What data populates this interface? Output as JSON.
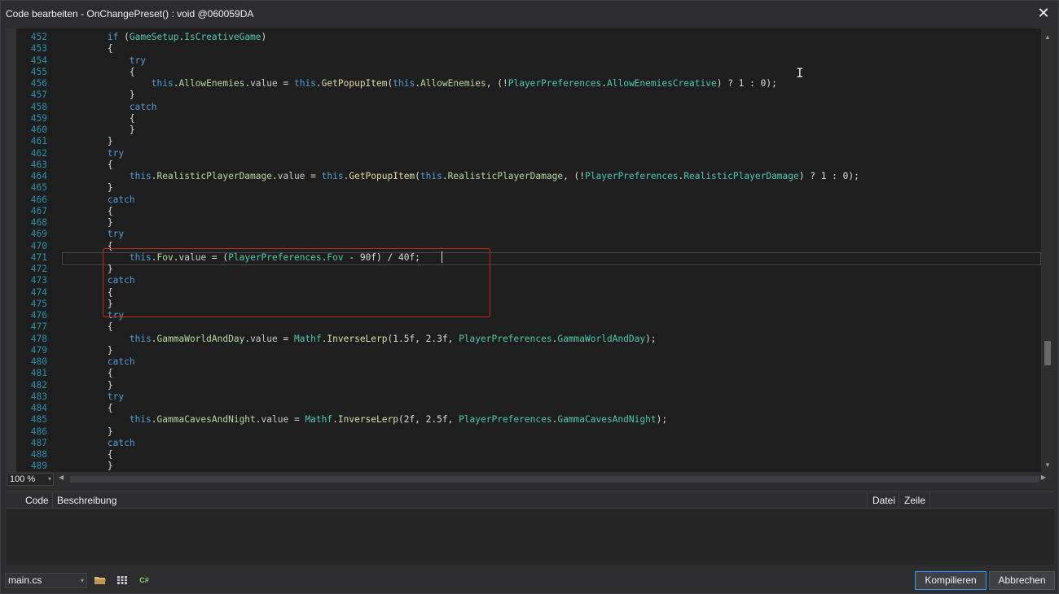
{
  "window": {
    "title": "Code bearbeiten - OnChangePreset() : void @060059DA",
    "close_glyph": "✕"
  },
  "editor": {
    "current_line": "471",
    "lines": [
      {
        "n": "452",
        "code": "        <span class=\"kw\">if</span> (<span class=\"ty\">GameSetup</span>.<span class=\"ty\">IsCreativeGame</span>)"
      },
      {
        "n": "453",
        "code": "        {"
      },
      {
        "n": "454",
        "code": "            <span class=\"kw\">try</span>"
      },
      {
        "n": "455",
        "code": "            {"
      },
      {
        "n": "456",
        "code": "                <span class=\"kw\">this</span>.<span class=\"id\">AllowEnemies</span>.<span class=\"pr\">value</span> = <span class=\"kw\">this</span>.<span class=\"m\">GetPopupItem</span>(<span class=\"kw\">this</span>.<span class=\"id\">AllowEnemies</span>, (!<span class=\"ty\">PlayerPreferences</span>.<span class=\"ty\">AllowEnemiesCreative</span>) ? 1 : 0);"
      },
      {
        "n": "457",
        "code": "            }"
      },
      {
        "n": "458",
        "code": "            <span class=\"kw\">catch</span>"
      },
      {
        "n": "459",
        "code": "            {"
      },
      {
        "n": "460",
        "code": "            }"
      },
      {
        "n": "461",
        "code": "        }"
      },
      {
        "n": "462",
        "code": "        <span class=\"kw\">try</span>"
      },
      {
        "n": "463",
        "code": "        {"
      },
      {
        "n": "464",
        "code": "            <span class=\"kw\">this</span>.<span class=\"id\">RealisticPlayerDamage</span>.<span class=\"pr\">value</span> = <span class=\"kw\">this</span>.<span class=\"m\">GetPopupItem</span>(<span class=\"kw\">this</span>.<span class=\"id\">RealisticPlayerDamage</span>, (!<span class=\"ty\">PlayerPreferences</span>.<span class=\"ty\">RealisticPlayerDamage</span>) ? 1 : 0);"
      },
      {
        "n": "465",
        "code": "        }"
      },
      {
        "n": "466",
        "code": "        <span class=\"kw\">catch</span>"
      },
      {
        "n": "467",
        "code": "        {"
      },
      {
        "n": "468",
        "code": "        }"
      },
      {
        "n": "469",
        "code": "        <span class=\"kw\">try</span>"
      },
      {
        "n": "470",
        "code": "        {"
      },
      {
        "n": "471",
        "code": "            <span class=\"kw\">this</span>.<span class=\"id\">Fov</span>.<span class=\"pr\">value</span> = (<span class=\"ty\">PlayerPreferences</span>.<span class=\"ty\">Fov</span> - 90f) / 40f;"
      },
      {
        "n": "472",
        "code": "        }"
      },
      {
        "n": "473",
        "code": "        <span class=\"kw\">catch</span>"
      },
      {
        "n": "474",
        "code": "        {"
      },
      {
        "n": "475",
        "code": "        }"
      },
      {
        "n": "476",
        "code": "        <span class=\"kw\">try</span>"
      },
      {
        "n": "477",
        "code": "        {"
      },
      {
        "n": "478",
        "code": "            <span class=\"kw\">this</span>.<span class=\"id\">GammaWorldAndDay</span>.<span class=\"pr\">value</span> = <span class=\"ty\">Mathf</span>.<span class=\"m\">InverseLerp</span>(1.5f, 2.3f, <span class=\"ty\">PlayerPreferences</span>.<span class=\"ty\">GammaWorldAndDay</span>);"
      },
      {
        "n": "479",
        "code": "        }"
      },
      {
        "n": "480",
        "code": "        <span class=\"kw\">catch</span>"
      },
      {
        "n": "481",
        "code": "        {"
      },
      {
        "n": "482",
        "code": "        }"
      },
      {
        "n": "483",
        "code": "        <span class=\"kw\">try</span>"
      },
      {
        "n": "484",
        "code": "        {"
      },
      {
        "n": "485",
        "code": "            <span class=\"kw\">this</span>.<span class=\"id\">GammaCavesAndNight</span>.<span class=\"pr\">value</span> = <span class=\"ty\">Mathf</span>.<span class=\"m\">InverseLerp</span>(2f, 2.5f, <span class=\"ty\">PlayerPreferences</span>.<span class=\"ty\">GammaCavesAndNight</span>);"
      },
      {
        "n": "486",
        "code": "        }"
      },
      {
        "n": "487",
        "code": "        <span class=\"kw\">catch</span>"
      },
      {
        "n": "488",
        "code": "        {"
      },
      {
        "n": "489",
        "code": "        }"
      }
    ]
  },
  "zoom": {
    "value": "100 %",
    "arrow": "▾"
  },
  "errorlist": {
    "col_code": "Code",
    "col_description": "Beschreibung",
    "col_file": "Datei",
    "col_line": "Zeile"
  },
  "bottombar": {
    "file": "main.cs",
    "compile_label": "Kompilieren",
    "cancel_label": "Abbrechen",
    "csharp_glyph": "C#"
  },
  "colors": {
    "keyword": "#569cd6",
    "type": "#4ec9b0",
    "method": "#dcdcaa",
    "line_number": "#2b91af",
    "highlight_box": "#c42b1c"
  }
}
